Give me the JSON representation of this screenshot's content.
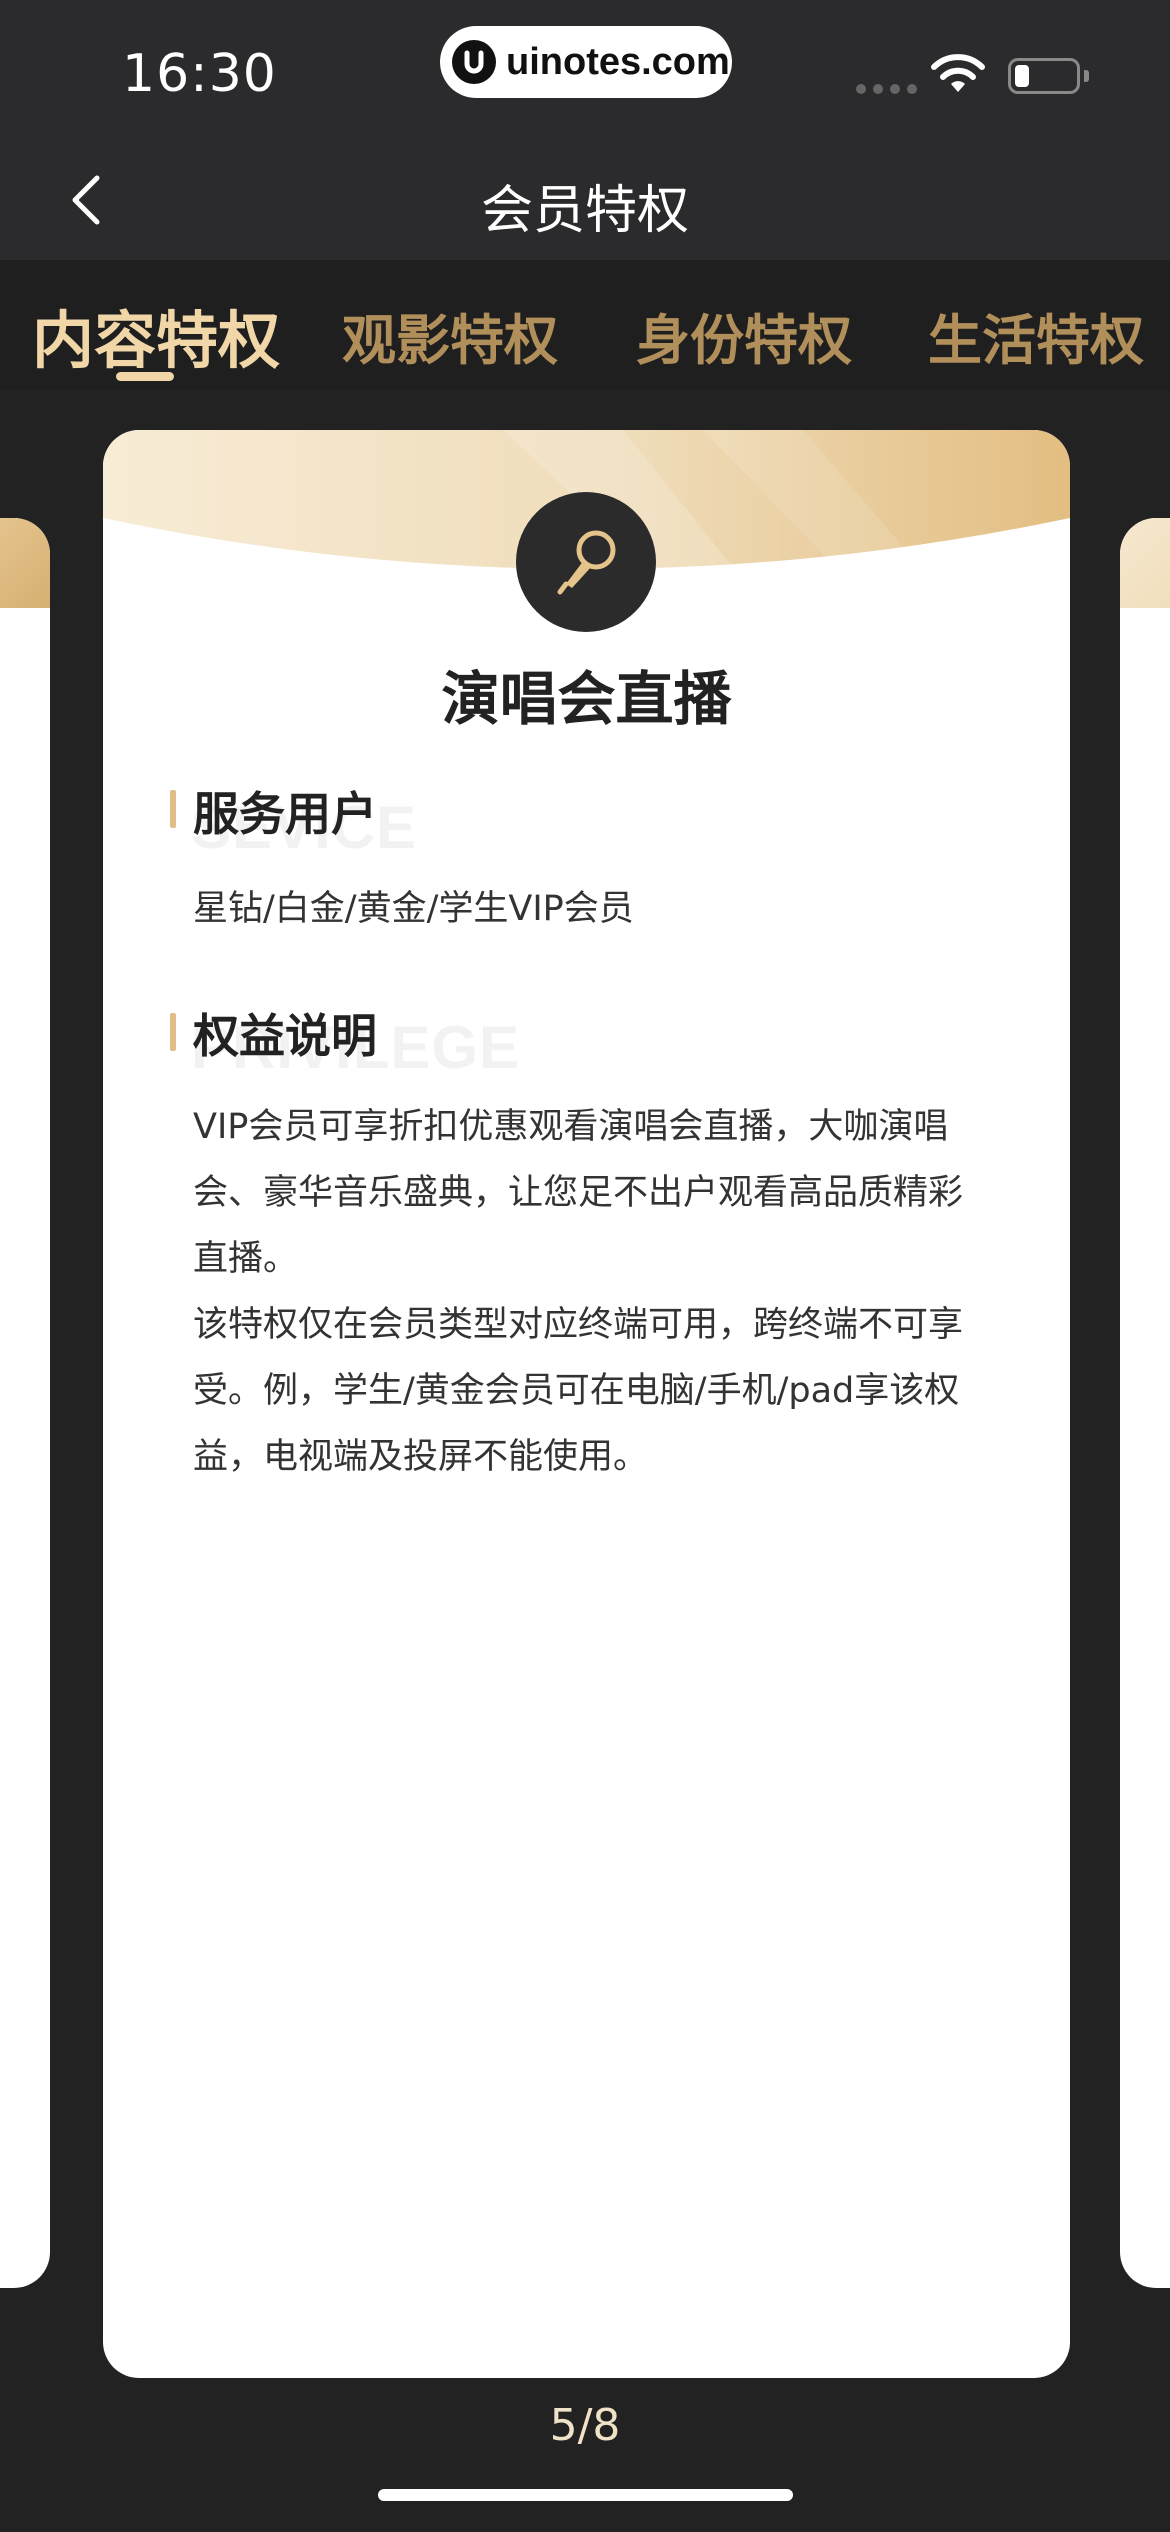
{
  "status_bar": {
    "time": "16:30",
    "url": "uinotes.com",
    "icons": [
      "signal-icon",
      "wifi-icon",
      "battery-icon"
    ]
  },
  "nav": {
    "title": "会员特权",
    "back_icon": "chevron-left-icon"
  },
  "tabs": [
    {
      "label": "内容特权",
      "active": true
    },
    {
      "label": "观影特权",
      "active": false
    },
    {
      "label": "身份特权",
      "active": false
    },
    {
      "label": "生活特权",
      "active": false
    }
  ],
  "card": {
    "icon": "microphone-icon",
    "title": "演唱会直播",
    "sections": [
      {
        "title": "服务用户",
        "watermark": "SEVICE",
        "text": "星钻/白金/黄金/学生VIP会员"
      },
      {
        "title": "权益说明",
        "watermark": "PRIVILEGE",
        "paragraph_1": "VIP会员可享折扣优惠观看演唱会直播，大咖演唱会、豪华音乐盛典，让您足不出户观看高品质精彩直播。",
        "paragraph_2": "该特权仅在会员类型对应终端可用，跨终端不可享受。例，学生/黄金会员可在电脑/手机/pad享该权益，电视端及投屏不能使用。"
      }
    ]
  },
  "pager": "5/8",
  "colors": {
    "background": "#222222",
    "nav_background": "#2b2b2d",
    "accent_gold": "#e0bf86",
    "tab_active": "#f1d6a8",
    "tab_inactive": "#b18f5a"
  }
}
